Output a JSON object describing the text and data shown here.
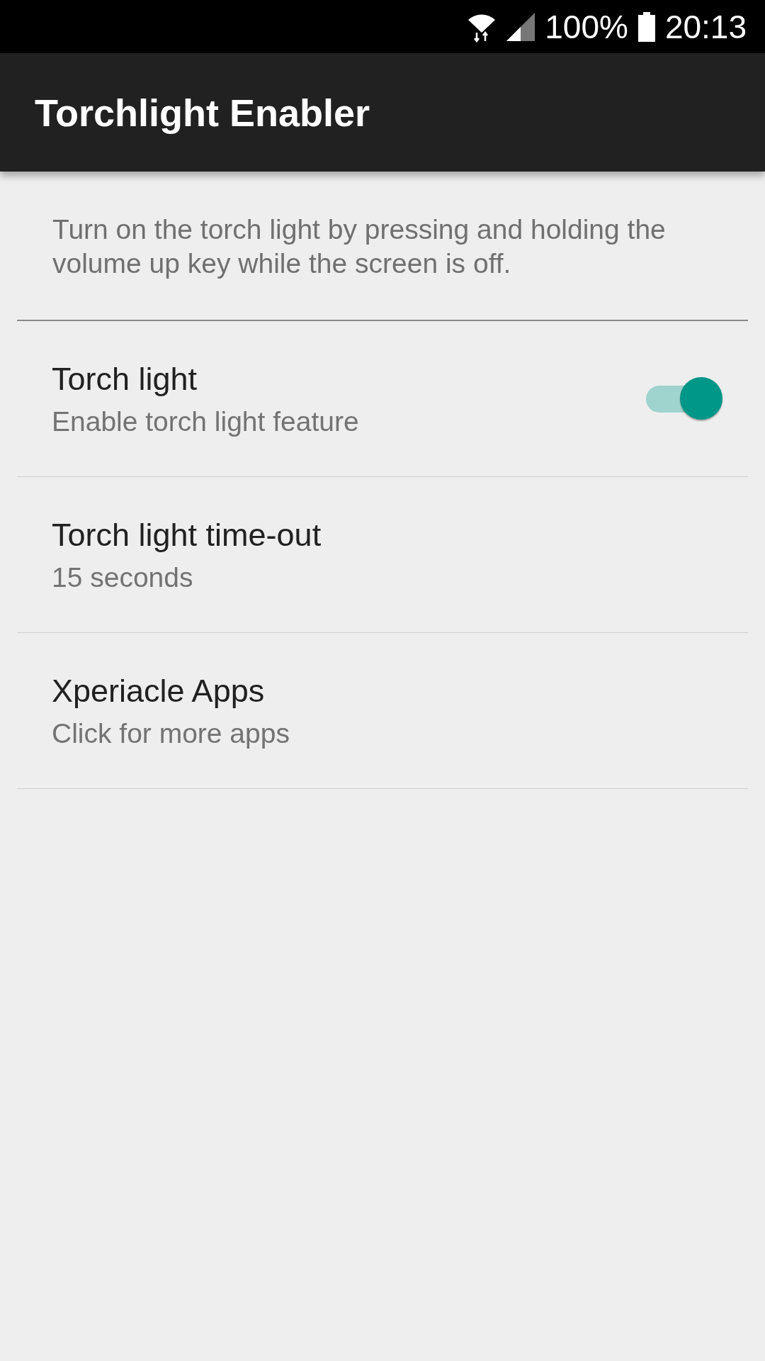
{
  "status_bar": {
    "battery_text": "100%",
    "time": "20:13"
  },
  "app_bar": {
    "title": "Torchlight Enabler"
  },
  "description": "Turn on the torch light by pressing and holding the volume up key while the screen is off.",
  "settings": [
    {
      "kind": "switch",
      "title": "Torch light",
      "summary": "Enable torch light feature",
      "on": true
    },
    {
      "kind": "plain",
      "title": "Torch light time-out",
      "summary": "15 seconds"
    },
    {
      "kind": "plain",
      "title": "Xperiacle Apps",
      "summary": "Click for more apps"
    }
  ]
}
